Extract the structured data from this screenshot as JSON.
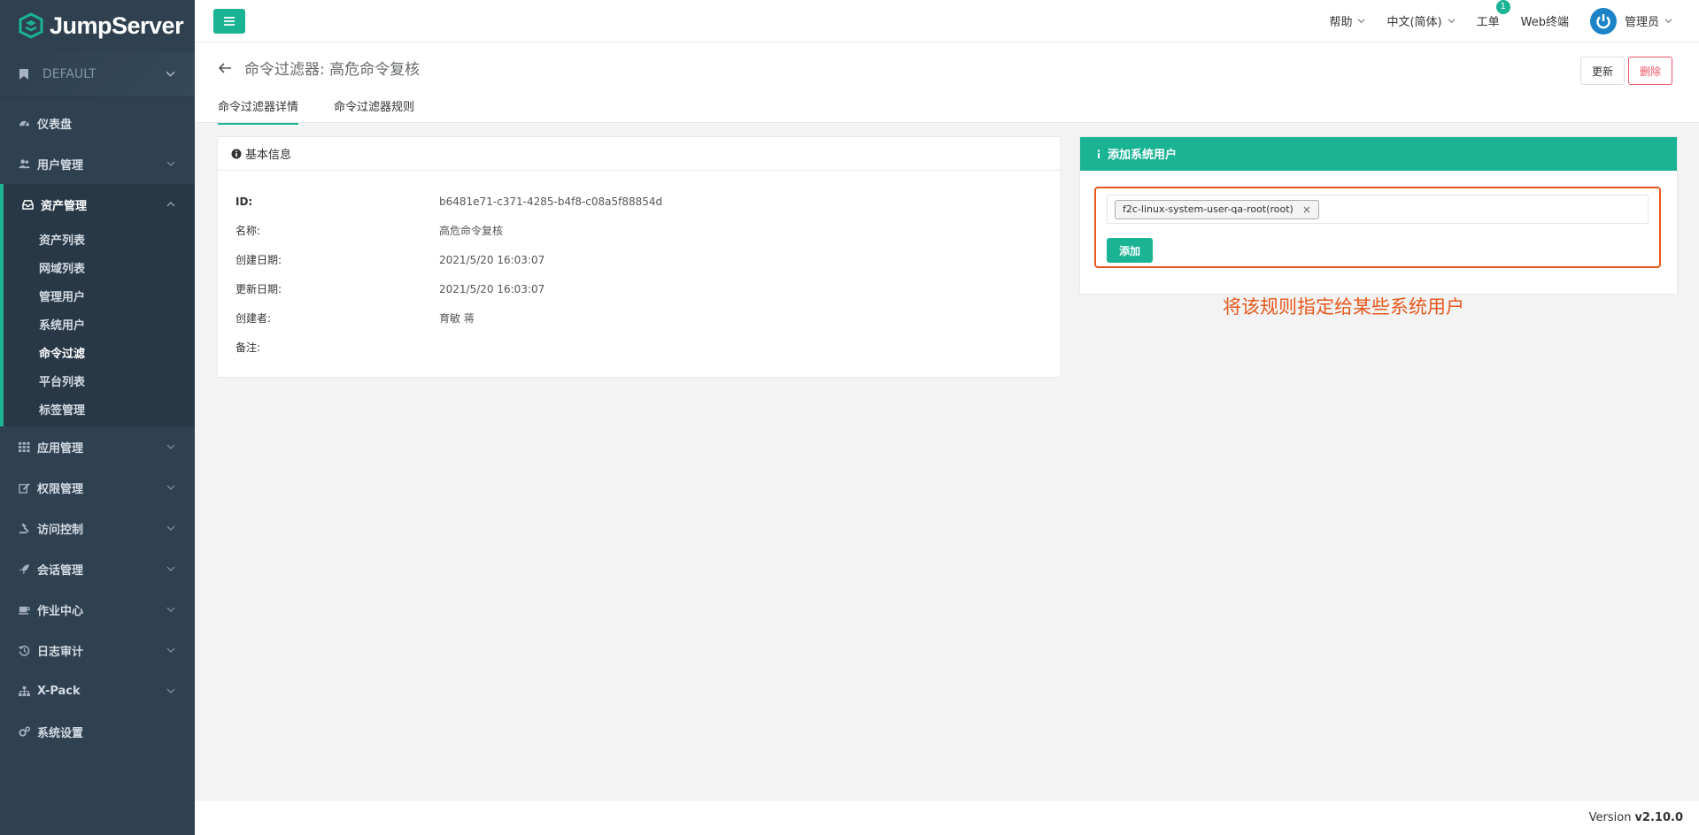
{
  "app": {
    "name": "JumpServer"
  },
  "org": {
    "label": "DEFAULT"
  },
  "sidebar": {
    "items": [
      {
        "label": "仪表盘",
        "icon": "dashboard-icon"
      },
      {
        "label": "用户管理",
        "icon": "users-icon"
      },
      {
        "label": "资产管理",
        "icon": "inbox-icon",
        "expanded": true,
        "children": [
          "资产列表",
          "网域列表",
          "管理用户",
          "系统用户",
          "命令过滤",
          "平台列表",
          "标签管理"
        ],
        "current_child": "命令过滤"
      },
      {
        "label": "应用管理",
        "icon": "grid-icon"
      },
      {
        "label": "权限管理",
        "icon": "edit-icon"
      },
      {
        "label": "访问控制",
        "icon": "gavel-icon"
      },
      {
        "label": "会话管理",
        "icon": "rocket-icon"
      },
      {
        "label": "作业中心",
        "icon": "coffee-icon"
      },
      {
        "label": "日志审计",
        "icon": "history-icon"
      },
      {
        "label": "X-Pack",
        "icon": "sitemap-icon"
      },
      {
        "label": "系统设置",
        "icon": "gears-icon"
      }
    ]
  },
  "topbar": {
    "help": "帮助",
    "language": "中文(简体)",
    "tickets": "工单",
    "tickets_badge": "1",
    "web_terminal": "Web终端",
    "user": "管理员"
  },
  "header": {
    "title": "命令过滤器: 高危命令复核",
    "tabs": [
      "命令过滤器详情",
      "命令过滤器规则"
    ],
    "active_tab": 0,
    "update_label": "更新",
    "delete_label": "删除"
  },
  "info_panel": {
    "title": "基本信息",
    "rows": [
      {
        "key": "ID:",
        "value": "b6481e71-c371-4285-b4f8-c08a5f88854d"
      },
      {
        "key": "名称:",
        "value": "高危命令复核"
      },
      {
        "key": "创建日期:",
        "value": "2021/5/20 16:03:07"
      },
      {
        "key": "更新日期:",
        "value": "2021/5/20 16:03:07"
      },
      {
        "key": "创建者:",
        "value": "育敏 蒋"
      },
      {
        "key": "备注:",
        "value": ""
      }
    ]
  },
  "add_panel": {
    "title": "添加系统用户",
    "selected_tag": "f2c-linux-system-user-qa-root(root)",
    "tag_remove": "×",
    "add_label": "添加"
  },
  "annotation": "将该规则指定给某些系统用户",
  "footer": {
    "version_label": "Version",
    "version": "v2.10.0"
  },
  "colors": {
    "sidebar": "#2f4050",
    "accent": "#1ab394",
    "danger": "#ed5565",
    "annotation": "#e8581c"
  }
}
